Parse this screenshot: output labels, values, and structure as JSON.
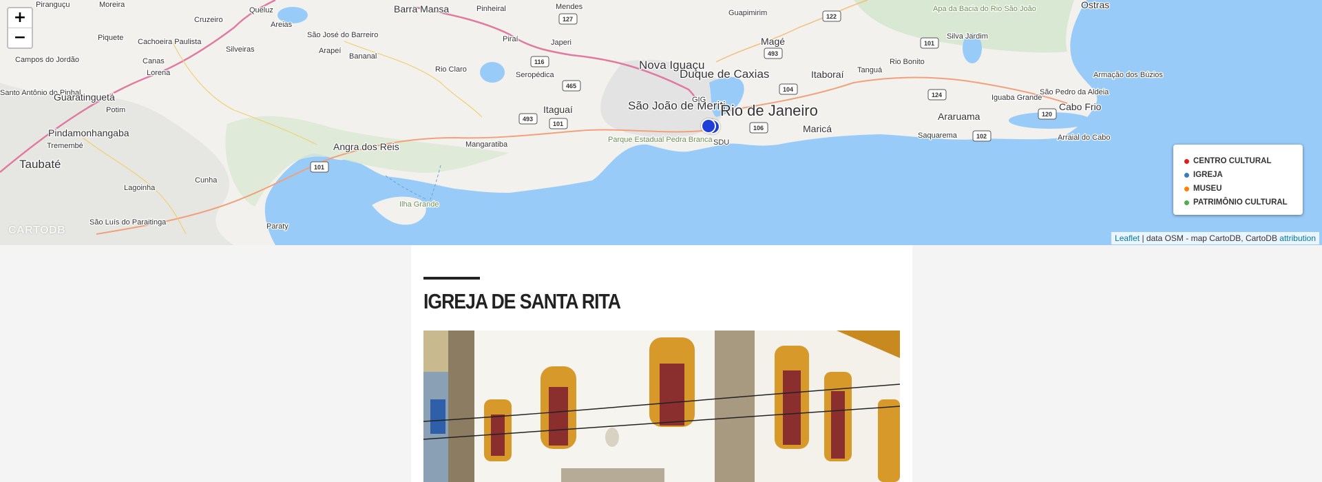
{
  "map": {
    "zoom_in_label": "+",
    "zoom_out_label": "−",
    "watermark": "CARTODB",
    "attribution": {
      "leaflet_link": "Leaflet",
      "text": " | data OSM - map CartoDB, CartoDB ",
      "attribution_link": "attribution"
    },
    "legend": [
      {
        "label": "CENTRO CULTURAL",
        "color": "#e41a1c"
      },
      {
        "label": "IGREJA",
        "color": "#377eb8"
      },
      {
        "label": "MUSEU",
        "color": "#ff7f00"
      },
      {
        "label": "PATRIMÔNIO CULTURAL",
        "color": "#4daf4a"
      }
    ],
    "marker_color": "#1f3fd9",
    "places": {
      "pirangucu": "Piranguçu",
      "moreira": "Moreira",
      "cruzeiro": "Cruzeiro",
      "queluz": "Queluz",
      "areias": "Areias",
      "barra_mansa": "Barra Mansa",
      "pinheiral": "Pinheiral",
      "mendes": "Mendes",
      "guapimirim": "Guapimirim",
      "ostras": "Ostras",
      "apa_bacia": "Apa da Bacia do Rio São João",
      "piquete": "Piquete",
      "cachoeira_paulista": "Cachoeira Paulista",
      "silveiras": "Silveiras",
      "sao_jose_barreiro": "São José do Barreiro",
      "arapei": "Arapeí",
      "bananal": "Bananal",
      "pirai": "Piraí",
      "japeri": "Japeri",
      "mage": "Magé",
      "silva_jardim": "Silva Jardim",
      "campos_jordao": "Campos do Jordão",
      "canas": "Canas",
      "lorena": "Lorena",
      "nova_iguacu": "Nova Iguaçu",
      "duque_caxias": "Duque de Caxias",
      "rio_bonito": "Rio Bonito",
      "tangua": "Tanguá",
      "itaborai": "Itaboraí",
      "armacao_buzios": "Armação dos Búzios",
      "santo_antonio_pinhal": "Santo Antônio do Pinhal",
      "guaratingueta": "Guaratinguetá",
      "rio_claro": "Rio Claro",
      "seropedica": "Seropédica",
      "sao_joao_meriti": "São João de Meriti",
      "rio_de_janeiro": "Rio de Janeiro",
      "potim": "Potim",
      "itaguai": "Itaguaí",
      "araruama": "Araruama",
      "iguaba_grande": "Iguaba Grande",
      "sao_pedro_aldeia": "São Pedro da Aldeia",
      "cabo_frio": "Cabo Frio",
      "pindamonhangaba": "Pindamonhangaba",
      "parque_pedra_branca": "Parque Estadual Pedra Branca",
      "marica": "Maricá",
      "saquarema": "Saquarema",
      "arraial_cabo": "Arraial do Cabo",
      "tremembe": "Tremembé",
      "angra_reis": "Angra dos Reis",
      "mangaratiba": "Mangaratiba",
      "taubate": "Taubaté",
      "lagoinha": "Lagoinha",
      "cunha": "Cunha",
      "ilha_grande": "Ilha Grande",
      "sao_luis_paraitinga": "São Luís do Paraitinga",
      "paraty": "Paraty",
      "gig": "GIG",
      "sdu": "SDU"
    },
    "shields": [
      "127",
      "122",
      "493",
      "101",
      "116",
      "465",
      "104",
      "493",
      "101",
      "124",
      "106",
      "102",
      "120",
      "101"
    ]
  },
  "article": {
    "title": "IGREJA DE SANTA RITA"
  }
}
